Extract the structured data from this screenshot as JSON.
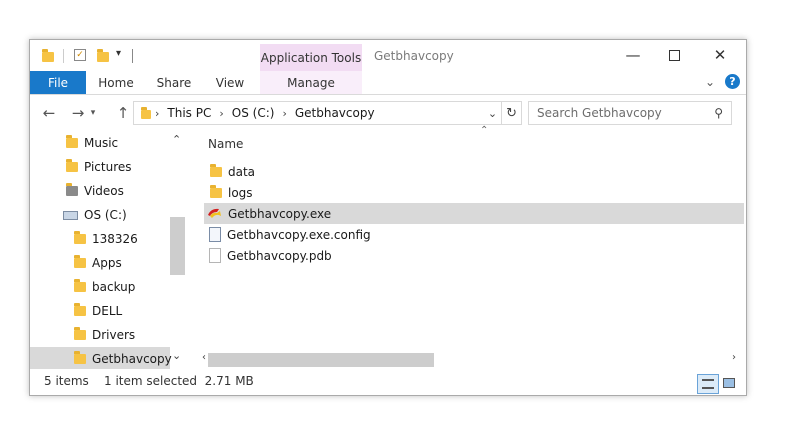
{
  "window": {
    "title": "Getbhavcopy",
    "context_tab": "Application Tools"
  },
  "ribbon": {
    "tabs": [
      "File",
      "Home",
      "Share",
      "View",
      "Manage"
    ]
  },
  "address": {
    "crumbs": [
      "This PC",
      "OS (C:)",
      "Getbhavcopy"
    ]
  },
  "search": {
    "placeholder": "Search Getbhavcopy"
  },
  "nav": {
    "items": [
      {
        "label": "Music",
        "icon": "music-folder-icon"
      },
      {
        "label": "Pictures",
        "icon": "pictures-folder-icon"
      },
      {
        "label": "Videos",
        "icon": "videos-folder-icon"
      },
      {
        "label": "OS (C:)",
        "icon": "drive-icon"
      },
      {
        "label": "138326",
        "icon": "folder-icon"
      },
      {
        "label": "Apps",
        "icon": "folder-icon"
      },
      {
        "label": "backup",
        "icon": "folder-icon"
      },
      {
        "label": "DELL",
        "icon": "folder-icon"
      },
      {
        "label": "Drivers",
        "icon": "folder-icon"
      },
      {
        "label": "Getbhavcopy",
        "icon": "folder-icon",
        "selected": true
      }
    ]
  },
  "content": {
    "column_name": "Name",
    "files": [
      {
        "name": "data",
        "type": "folder"
      },
      {
        "name": "logs",
        "type": "folder"
      },
      {
        "name": "Getbhavcopy.exe",
        "type": "exe",
        "selected": true
      },
      {
        "name": "Getbhavcopy.exe.config",
        "type": "config"
      },
      {
        "name": "Getbhavcopy.pdb",
        "type": "pdb"
      }
    ]
  },
  "status": {
    "count": "5 items",
    "selection": "1 item selected  2.71 MB"
  },
  "colors": {
    "file_tab": "#1979ca",
    "context_tab": "#f2dcf3",
    "selection": "#d9d9d9"
  }
}
